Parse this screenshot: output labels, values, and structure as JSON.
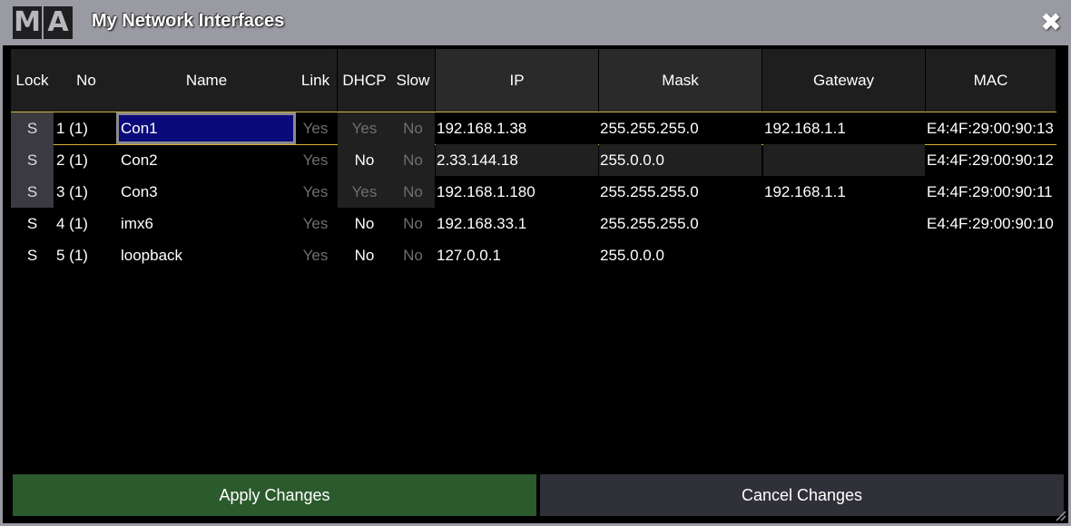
{
  "window": {
    "logo": [
      "M",
      "A"
    ],
    "title": "My Network Interfaces",
    "close_label": "✖"
  },
  "columns": [
    "Lock",
    "No",
    "Name",
    "Link",
    "DHCP",
    "Slow",
    "IP",
    "Mask",
    "Gateway",
    "MAC"
  ],
  "rows": [
    {
      "lock": "S",
      "no": "1 (1)",
      "name": "Con1",
      "link": "Yes",
      "dhcp": "Yes",
      "slow": "No",
      "ip": "192.168.1.38",
      "mask": "255.255.255.0",
      "gateway": "192.168.1.1",
      "mac": "E4:4F:29:00:90:13"
    },
    {
      "lock": "S",
      "no": "2 (1)",
      "name": "Con2",
      "link": "Yes",
      "dhcp": "No",
      "slow": "No",
      "ip": "2.33.144.18",
      "mask": "255.0.0.0",
      "gateway": "",
      "mac": "E4:4F:29:00:90:12"
    },
    {
      "lock": "S",
      "no": "3 (1)",
      "name": "Con3",
      "link": "Yes",
      "dhcp": "Yes",
      "slow": "No",
      "ip": "192.168.1.180",
      "mask": "255.255.255.0",
      "gateway": "192.168.1.1",
      "mac": "E4:4F:29:00:90:11"
    },
    {
      "lock": "S",
      "no": "4 (1)",
      "name": "imx6",
      "link": "Yes",
      "dhcp": "No",
      "slow": "No",
      "ip": "192.168.33.1",
      "mask": "255.255.255.0",
      "gateway": "",
      "mac": "E4:4F:29:00:90:10"
    },
    {
      "lock": "S",
      "no": "5 (1)",
      "name": "loopback",
      "link": "Yes",
      "dhcp": "No",
      "slow": "No",
      "ip": "127.0.0.1",
      "mask": "255.0.0.0",
      "gateway": "",
      "mac": ""
    }
  ],
  "buttons": {
    "apply": "Apply Changes",
    "cancel": "Cancel Changes"
  },
  "colors": {
    "apply_bg": "#2b5a2c",
    "cancel_bg": "#303038",
    "selection_line": "#d4b23a",
    "selected_cell": "#0a0a7a"
  }
}
